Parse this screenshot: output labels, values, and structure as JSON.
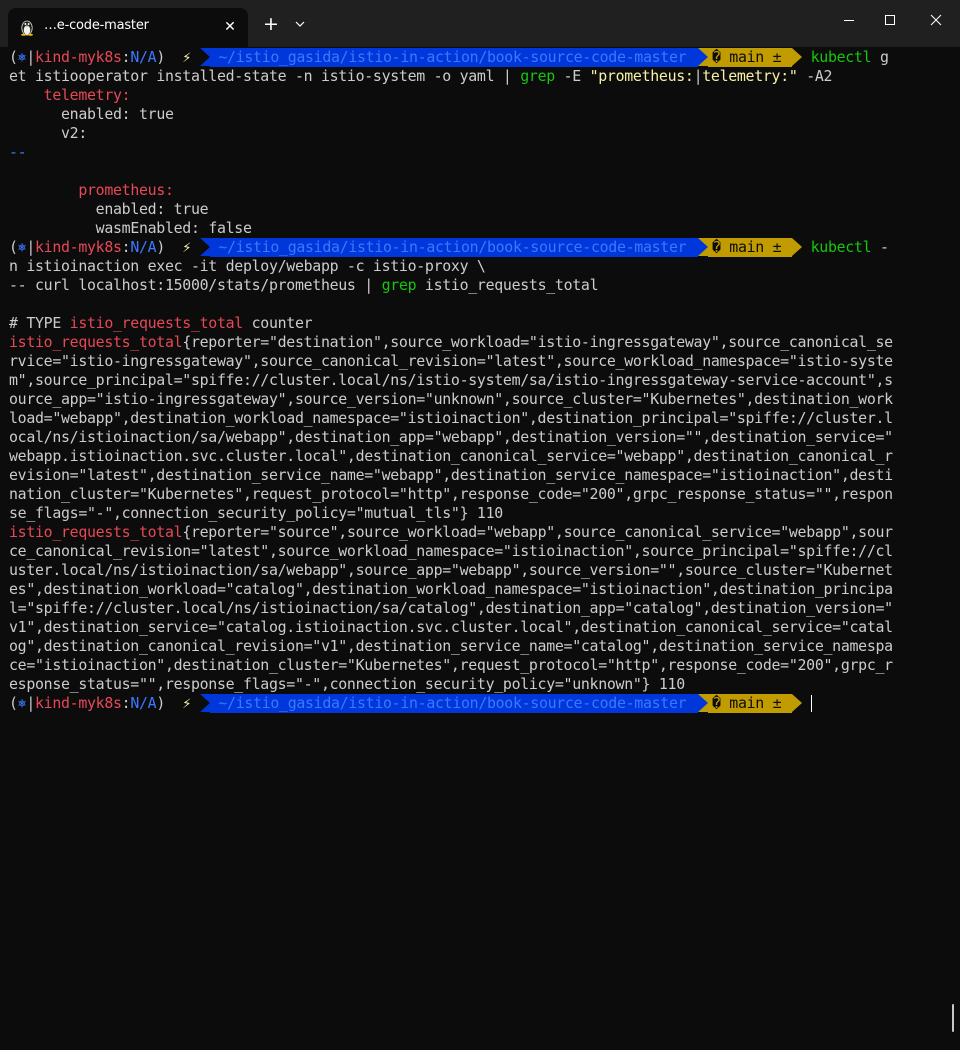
{
  "window": {
    "tab_title": "…e-code-master",
    "tab_icon": "linux-tux-icon",
    "close_tab_glyph": "✕",
    "new_tab_glyph": "+",
    "colors": {
      "background": "#0c0c0c",
      "titlebar": "#202020",
      "path_segment": "#0037da",
      "git_segment": "#c19c00",
      "red": "#e74856",
      "green": "#16c60c",
      "yellow": "#f9f1a5"
    }
  },
  "prompt": {
    "open": "(",
    "k8s_icon": "⎈",
    "sep": "|",
    "context": "kind-myk8s",
    "colon": ":",
    "namespace": "N/A",
    "close": ")",
    "bolt": "⚡",
    "path": " ~/istio_gasida/istio-in-action/book-source-code-master ",
    "git": "� main ± "
  },
  "cmd1": {
    "part1_cmd": "kubectl",
    "part1_rest": " g",
    "line2_a": "et istiooperator installed-state -n istio-system -o yaml | ",
    "line2_grep": "grep",
    "line2_b": " -E ",
    "line2_str_a": "\"prometheus:",
    "line2_str_sep": "|",
    "line2_str_b": "telemetry:\"",
    "line2_c": " -A2"
  },
  "out1": {
    "telemetry_key": "telemetry:",
    "enabled_key": "enabled",
    "enabled_val": ": true",
    "v2_key": "v2",
    "v2_val": ":",
    "separator": "--",
    "prometheus_key": "prometheus:",
    "p_enabled_key": "enabled",
    "p_enabled_val": ": true",
    "wasm_key": "wasmEnabled",
    "wasm_val": ": false"
  },
  "cmd2": {
    "part1_cmd": "kubectl",
    "part1_rest": " -",
    "line2": "n istioinaction exec -it deploy/webapp -c istio-proxy \\",
    "line3_a": "-- curl localhost:15000/stats/prometheus | ",
    "line3_grep": "grep",
    "line3_b": " istio_requests_total"
  },
  "out2": {
    "type_a": "# TYPE ",
    "type_metric": "istio_requests_total",
    "type_b": " counter",
    "metric_name": "istio_requests_total",
    "m1_lines": [
      "{reporter=\"destination\",source_workload=\"istio-ingressgateway\",source_canonical_se",
      "rvice=\"istio-ingressgateway\",source_canonical_revision=\"latest\",source_workload_namespace=\"istio-syste",
      "m\",source_principal=\"spiffe://cluster.local/ns/istio-system/sa/istio-ingressgateway-service-account\",s",
      "ource_app=\"istio-ingressgateway\",source_version=\"unknown\",source_cluster=\"Kubernetes\",destination_work",
      "load=\"webapp\",destination_workload_namespace=\"istioinaction\",destination_principal=\"spiffe://cluster.l",
      "ocal/ns/istioinaction/sa/webapp\",destination_app=\"webapp\",destination_version=\"\",destination_service=\"",
      "webapp.istioinaction.svc.cluster.local\",destination_canonical_service=\"webapp\",destination_canonical_r",
      "evision=\"latest\",destination_service_name=\"webapp\",destination_service_namespace=\"istioinaction\",desti",
      "nation_cluster=\"Kubernetes\",request_protocol=\"http\",response_code=\"200\",grpc_response_status=\"\",respon",
      "se_flags=\"-\",connection_security_policy=\"mutual_tls\"} 110"
    ],
    "m2_lines": [
      "{reporter=\"source\",source_workload=\"webapp\",source_canonical_service=\"webapp\",sour",
      "ce_canonical_revision=\"latest\",source_workload_namespace=\"istioinaction\",source_principal=\"spiffe://cl",
      "uster.local/ns/istioinaction/sa/webapp\",source_app=\"webapp\",source_version=\"\",source_cluster=\"Kubernet",
      "es\",destination_workload=\"catalog\",destination_workload_namespace=\"istioinaction\",destination_principa",
      "l=\"spiffe://cluster.local/ns/istioinaction/sa/catalog\",destination_app=\"catalog\",destination_version=\"",
      "v1\",destination_service=\"catalog.istioinaction.svc.cluster.local\",destination_canonical_service=\"catal",
      "og\",destination_canonical_revision=\"v1\",destination_service_name=\"catalog\",destination_service_namespa",
      "ce=\"istioinaction\",destination_cluster=\"Kubernetes\",request_protocol=\"http\",response_code=\"200\",grpc_r",
      "esponse_status=\"\",response_flags=\"-\",connection_security_policy=\"unknown\"} 110"
    ]
  }
}
